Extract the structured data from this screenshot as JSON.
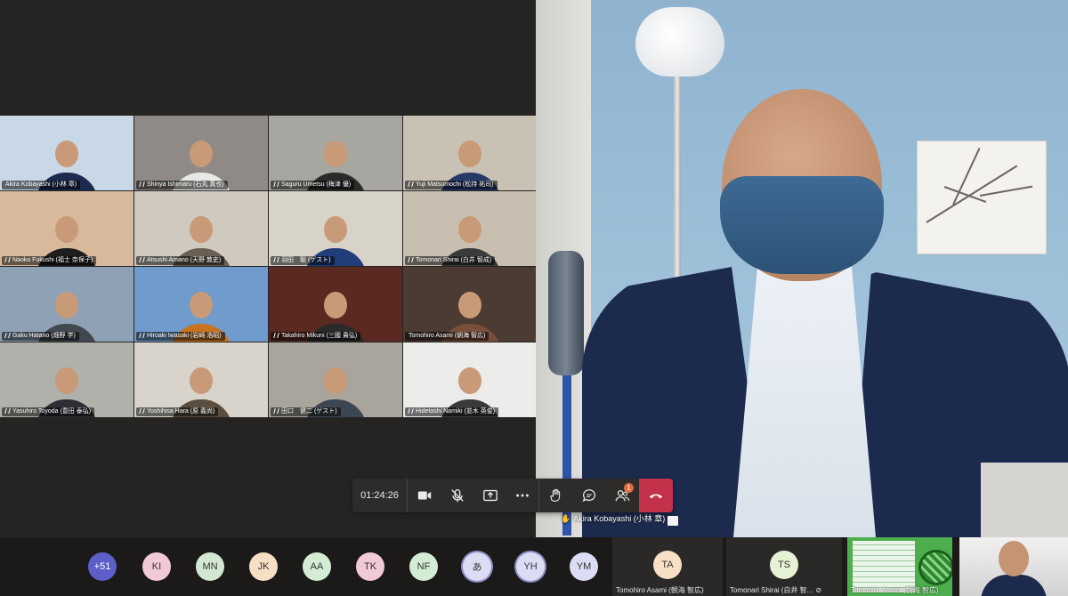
{
  "call": {
    "timer": "01:24:26",
    "participants_badge": "1",
    "active_speaker": "Akira Kobayashi (小林 章)"
  },
  "grid_tiles": [
    {
      "name": "Akira Kobayashi (小林 章)",
      "bg": "#c8d8e6",
      "pinned": false,
      "shirt": "#1c2a4d"
    },
    {
      "name": "Shinya Ishimaru (石丸 真也)",
      "bg": "#8f8a86",
      "pinned": true,
      "shirt": "#e8e8e6"
    },
    {
      "name": "Saguru Umetsu (梅津 優)",
      "bg": "#a7a6a1",
      "pinned": true,
      "shirt": "#2a2a2a"
    },
    {
      "name": "Yuji Matsumochi (松持 祐司)",
      "bg": "#c9c2b4",
      "pinned": true,
      "shirt": "#263a6a"
    },
    {
      "name": "Naoko Fukushi (福士 奈保子)",
      "bg": "#d9b99c",
      "pinned": true,
      "shirt": "#1e1e1e"
    },
    {
      "name": "Atsushi Amano (天野 敦史)",
      "bg": "#cfc9c0",
      "pinned": true,
      "shirt": "#6a5f52"
    },
    {
      "name": "羽田　聡 (ゲスト)",
      "bg": "#d8d3c8",
      "pinned": true,
      "shirt": "#1f3e7a"
    },
    {
      "name": "Tomonari Shirai (白井 智成)",
      "bg": "#c9bfb0",
      "pinned": true,
      "shirt": "#3b3b3b"
    },
    {
      "name": "Gaku Hatano (畑野 学)",
      "bg": "#8fa2b5",
      "pinned": true,
      "shirt": "#41484f"
    },
    {
      "name": "Hiroaki Iwasaki (岩崎 浩昭)",
      "bg": "#6f9ccc",
      "pinned": true,
      "shirt": "#c7731f"
    },
    {
      "name": "Takahiro Mikuni (三國 貴弘)",
      "bg": "#5a2a22",
      "pinned": true,
      "shirt": "#2a2a2a"
    },
    {
      "name": "Tomohiro Asami (朝海 智広)",
      "bg": "#4b3b33",
      "pinned": false,
      "shirt": "#7a4f3a"
    },
    {
      "name": "Yasuhiro Toyoda (豊田 泰弘)",
      "bg": "#b1b1ab",
      "pinned": true,
      "shirt": "#2e2e35"
    },
    {
      "name": "Yoshihisa Hara (原 義尚)",
      "bg": "#d9d4cb",
      "pinned": true,
      "shirt": "#5b4e3e"
    },
    {
      "name": "田口　健二 (ゲスト)",
      "bg": "#a9a49c",
      "pinned": true,
      "shirt": "#3d4752"
    },
    {
      "name": "Hidetoshi Namiki (並木 英俊)",
      "bg": "#ececea",
      "pinned": true,
      "shirt": "#3a3a3a"
    }
  ],
  "roster": {
    "overflow": "+51",
    "avatars": [
      {
        "initials": "KI",
        "color": "#f2c9d8",
        "ring": false
      },
      {
        "initials": "MN",
        "color": "#d2e8d2",
        "ring": false
      },
      {
        "initials": "JK",
        "color": "#f7dfc5",
        "ring": false
      },
      {
        "initials": "AA",
        "color": "#d4ecd4",
        "ring": false
      },
      {
        "initials": "TK",
        "color": "#f2c9d8",
        "ring": false
      },
      {
        "initials": "NF",
        "color": "#d4ecd4",
        "ring": false
      },
      {
        "initials": "あ",
        "color": "#dcdcf4",
        "ring": true
      },
      {
        "initials": "YH",
        "color": "#dcdcf4",
        "ring": true
      },
      {
        "initials": "YM",
        "color": "#dcdcf4",
        "ring": false
      }
    ],
    "named_tiles": [
      {
        "initials": "TA",
        "name": "Tomohiro Asami (朝海 智広)",
        "color": "#f7e0c4"
      },
      {
        "initials": "TS",
        "name": "Tomonari Shirai (白井 智...",
        "color": "#e5f2d6"
      }
    ],
    "screen_share_name": "Tomohiro Asami (朝海 智広)"
  }
}
